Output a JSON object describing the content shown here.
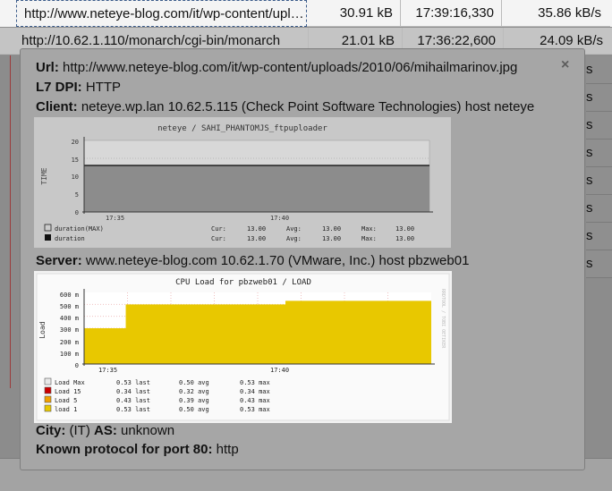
{
  "table": {
    "rows": [
      {
        "url": "http://www.neteye-blog.com/it/wp-content/uploads/2010/06/mihailmarinov.jpg",
        "size": "30.91 kB",
        "time": "17:39:16,330",
        "rate": "35.86 kB/s"
      },
      {
        "url": "http://10.62.1.110/monarch/cgi-bin/monarch",
        "size": "21.01 kB",
        "time": "17:36:22,600",
        "rate": "24.09 kB/s"
      }
    ],
    "edge_rates": [
      "s",
      "s",
      "s",
      "s",
      "s",
      "s",
      "s",
      "s"
    ]
  },
  "tooltip": {
    "close_glyph": "×",
    "url_label": "Url:",
    "url_value": "http://www.neteye-blog.com/it/wp-content/uploads/2010/06/mihailmarinov.jpg",
    "dpi_label": "L7 DPI:",
    "dpi_value": "HTTP",
    "client_label": "Client:",
    "client_value": "neteye.wp.lan 10.62.5.115 (Check Point Software Technologies) host neteye",
    "server_label": "Server:",
    "server_value": "www.neteye-blog.com 10.62.1.70 (VMware, Inc.) host pbzweb01",
    "city_label": "City:",
    "city_value": "(IT)",
    "as_label": "AS:",
    "as_value": "unknown",
    "protocol_label": "Known protocol for port 80:",
    "protocol_value": "http"
  },
  "chart_data": [
    {
      "type": "area",
      "title": "neteye / SAHI_PHANTOMJS_ftpuploader",
      "ylabel": "TIME",
      "ylim": [
        0,
        20
      ],
      "yticks": [
        "20",
        "15",
        "10",
        "5",
        "0"
      ],
      "xticks": [
        "17:35",
        "17:40"
      ],
      "series": [
        {
          "name": "duration(MAX)",
          "cur": "13.00",
          "avg": "13.00",
          "max": "13.00"
        },
        {
          "name": "duration",
          "cur": "13.00",
          "avg": "13.00",
          "max": "13.00"
        }
      ],
      "values": [
        13,
        13
      ],
      "stat_labels": {
        "cur": "Cur:",
        "avg": "Avg:",
        "max": "Max:"
      },
      "colors": {
        "fill": "#8c8c8c",
        "line": "#222222"
      }
    },
    {
      "type": "area",
      "title": "CPU Load for pbzweb01 / LOAD",
      "ylabel": "Load",
      "ylim": [
        0,
        600
      ],
      "yticks": [
        "600 m",
        "500 m",
        "400 m",
        "300 m",
        "200 m",
        "100 m",
        "0"
      ],
      "xticks": [
        "17:35",
        "17:40"
      ],
      "side_label": "RRDTOOL / TOBI OETIKER",
      "x": [
        0,
        0.12,
        0.12,
        0.58,
        0.58,
        1.0
      ],
      "y": [
        300,
        300,
        500,
        500,
        530,
        530
      ],
      "series": [
        {
          "name": "Load Max",
          "color": "#e8e8e8",
          "last": "0.53 last",
          "avg": "0.50 avg",
          "max": "0.53 max"
        },
        {
          "name": "Load 15",
          "color": "#cc0000",
          "last": "0.34 last",
          "avg": "0.32 avg",
          "max": "0.34 max"
        },
        {
          "name": "Load 5",
          "color": "#f0a000",
          "last": "0.43 last",
          "avg": "0.39 avg",
          "max": "0.43 max"
        },
        {
          "name": "load 1",
          "color": "#e8c800",
          "last": "0.53 last",
          "avg": "0.50 avg",
          "max": "0.53 max"
        }
      ],
      "colors": {
        "fill": "#e8c800"
      }
    }
  ]
}
